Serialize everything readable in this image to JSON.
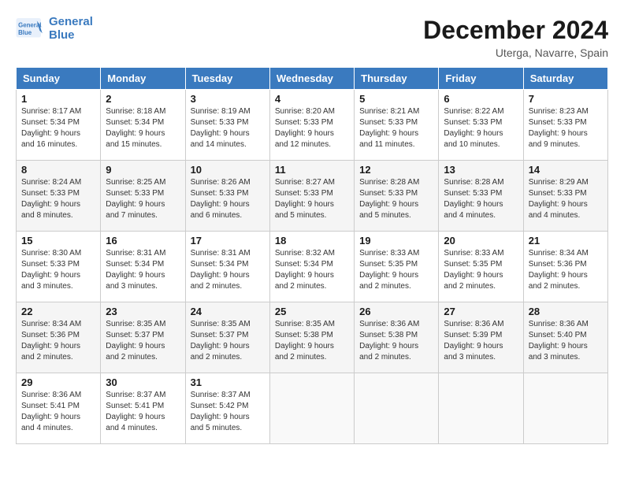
{
  "header": {
    "logo": {
      "line1": "General",
      "line2": "Blue"
    },
    "title": "December 2024",
    "location": "Uterga, Navarre, Spain"
  },
  "weekdays": [
    "Sunday",
    "Monday",
    "Tuesday",
    "Wednesday",
    "Thursday",
    "Friday",
    "Saturday"
  ],
  "weeks": [
    [
      {
        "day": "1",
        "info": "Sunrise: 8:17 AM\nSunset: 5:34 PM\nDaylight: 9 hours\nand 16 minutes."
      },
      {
        "day": "2",
        "info": "Sunrise: 8:18 AM\nSunset: 5:34 PM\nDaylight: 9 hours\nand 15 minutes."
      },
      {
        "day": "3",
        "info": "Sunrise: 8:19 AM\nSunset: 5:33 PM\nDaylight: 9 hours\nand 14 minutes."
      },
      {
        "day": "4",
        "info": "Sunrise: 8:20 AM\nSunset: 5:33 PM\nDaylight: 9 hours\nand 12 minutes."
      },
      {
        "day": "5",
        "info": "Sunrise: 8:21 AM\nSunset: 5:33 PM\nDaylight: 9 hours\nand 11 minutes."
      },
      {
        "day": "6",
        "info": "Sunrise: 8:22 AM\nSunset: 5:33 PM\nDaylight: 9 hours\nand 10 minutes."
      },
      {
        "day": "7",
        "info": "Sunrise: 8:23 AM\nSunset: 5:33 PM\nDaylight: 9 hours\nand 9 minutes."
      }
    ],
    [
      {
        "day": "8",
        "info": "Sunrise: 8:24 AM\nSunset: 5:33 PM\nDaylight: 9 hours\nand 8 minutes."
      },
      {
        "day": "9",
        "info": "Sunrise: 8:25 AM\nSunset: 5:33 PM\nDaylight: 9 hours\nand 7 minutes."
      },
      {
        "day": "10",
        "info": "Sunrise: 8:26 AM\nSunset: 5:33 PM\nDaylight: 9 hours\nand 6 minutes."
      },
      {
        "day": "11",
        "info": "Sunrise: 8:27 AM\nSunset: 5:33 PM\nDaylight: 9 hours\nand 5 minutes."
      },
      {
        "day": "12",
        "info": "Sunrise: 8:28 AM\nSunset: 5:33 PM\nDaylight: 9 hours\nand 5 minutes."
      },
      {
        "day": "13",
        "info": "Sunrise: 8:28 AM\nSunset: 5:33 PM\nDaylight: 9 hours\nand 4 minutes."
      },
      {
        "day": "14",
        "info": "Sunrise: 8:29 AM\nSunset: 5:33 PM\nDaylight: 9 hours\nand 4 minutes."
      }
    ],
    [
      {
        "day": "15",
        "info": "Sunrise: 8:30 AM\nSunset: 5:33 PM\nDaylight: 9 hours\nand 3 minutes."
      },
      {
        "day": "16",
        "info": "Sunrise: 8:31 AM\nSunset: 5:34 PM\nDaylight: 9 hours\nand 3 minutes."
      },
      {
        "day": "17",
        "info": "Sunrise: 8:31 AM\nSunset: 5:34 PM\nDaylight: 9 hours\nand 2 minutes."
      },
      {
        "day": "18",
        "info": "Sunrise: 8:32 AM\nSunset: 5:34 PM\nDaylight: 9 hours\nand 2 minutes."
      },
      {
        "day": "19",
        "info": "Sunrise: 8:33 AM\nSunset: 5:35 PM\nDaylight: 9 hours\nand 2 minutes."
      },
      {
        "day": "20",
        "info": "Sunrise: 8:33 AM\nSunset: 5:35 PM\nDaylight: 9 hours\nand 2 minutes."
      },
      {
        "day": "21",
        "info": "Sunrise: 8:34 AM\nSunset: 5:36 PM\nDaylight: 9 hours\nand 2 minutes."
      }
    ],
    [
      {
        "day": "22",
        "info": "Sunrise: 8:34 AM\nSunset: 5:36 PM\nDaylight: 9 hours\nand 2 minutes."
      },
      {
        "day": "23",
        "info": "Sunrise: 8:35 AM\nSunset: 5:37 PM\nDaylight: 9 hours\nand 2 minutes."
      },
      {
        "day": "24",
        "info": "Sunrise: 8:35 AM\nSunset: 5:37 PM\nDaylight: 9 hours\nand 2 minutes."
      },
      {
        "day": "25",
        "info": "Sunrise: 8:35 AM\nSunset: 5:38 PM\nDaylight: 9 hours\nand 2 minutes."
      },
      {
        "day": "26",
        "info": "Sunrise: 8:36 AM\nSunset: 5:38 PM\nDaylight: 9 hours\nand 2 minutes."
      },
      {
        "day": "27",
        "info": "Sunrise: 8:36 AM\nSunset: 5:39 PM\nDaylight: 9 hours\nand 3 minutes."
      },
      {
        "day": "28",
        "info": "Sunrise: 8:36 AM\nSunset: 5:40 PM\nDaylight: 9 hours\nand 3 minutes."
      }
    ],
    [
      {
        "day": "29",
        "info": "Sunrise: 8:36 AM\nSunset: 5:41 PM\nDaylight: 9 hours\nand 4 minutes."
      },
      {
        "day": "30",
        "info": "Sunrise: 8:37 AM\nSunset: 5:41 PM\nDaylight: 9 hours\nand 4 minutes."
      },
      {
        "day": "31",
        "info": "Sunrise: 8:37 AM\nSunset: 5:42 PM\nDaylight: 9 hours\nand 5 minutes."
      },
      {
        "day": "",
        "info": ""
      },
      {
        "day": "",
        "info": ""
      },
      {
        "day": "",
        "info": ""
      },
      {
        "day": "",
        "info": ""
      }
    ]
  ]
}
